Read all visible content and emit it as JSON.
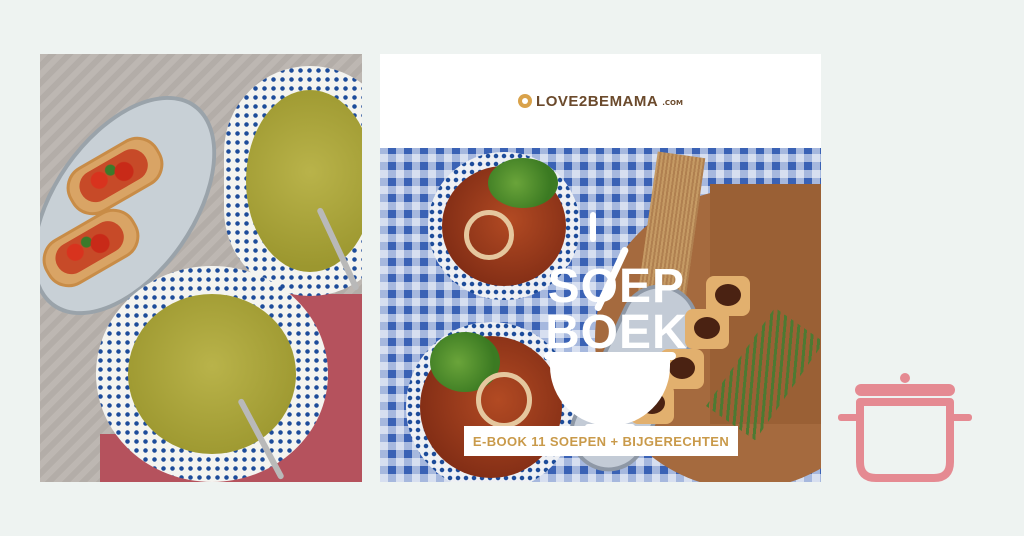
{
  "brand": {
    "name": "LOVE2BEMAMA",
    "domain_suffix": ".COM",
    "color": "#6b4a2c"
  },
  "ebook": {
    "title_line1": "SOEP",
    "title_line2": "BOEK",
    "banner_text": "E-BOOK 11 SOEPEN + BIJGERECHTEN",
    "banner_text_color": "#c99a4a"
  },
  "colors": {
    "background": "#eef3f1",
    "pot_icon": "#e58a92",
    "gingham_blue": "#3a62b5"
  },
  "icons": {
    "pot": "cooking-pot-icon",
    "logo_mark": "love2bemama-logo-icon"
  }
}
